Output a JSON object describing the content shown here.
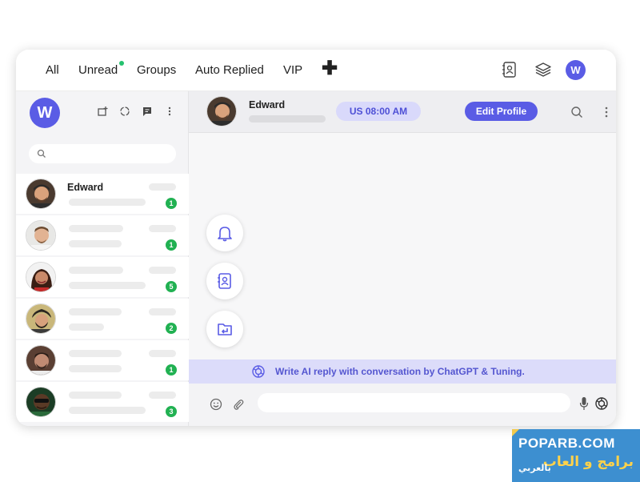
{
  "topbar": {
    "tabs": [
      {
        "label": "All"
      },
      {
        "label": "Unread"
      },
      {
        "label": "Groups"
      },
      {
        "label": "Auto Replied"
      },
      {
        "label": "VIP"
      }
    ],
    "add_icon": "plus-icon",
    "right_icons": [
      "contacts-book-icon",
      "layers-icon",
      "brand-logo"
    ],
    "unread_dot_color": "#25c16f"
  },
  "sidebar": {
    "header_icons": [
      "new-chat-icon",
      "status-icon",
      "message-icon",
      "more-vertical-icon"
    ],
    "search": {
      "placeholder": "",
      "value": ""
    },
    "chats": [
      {
        "name": "Edward",
        "unread": "1"
      },
      {
        "name": "",
        "unread": "1"
      },
      {
        "name": "",
        "unread": "5"
      },
      {
        "name": "",
        "unread": "2"
      },
      {
        "name": "",
        "unread": "1"
      },
      {
        "name": "",
        "unread": "3"
      }
    ]
  },
  "chat": {
    "contact_name": "Edward",
    "local_time": "US 08:00 AM",
    "edit_profile_label": "Edit Profile",
    "floating_actions": [
      "bell-icon",
      "contact-card-icon",
      "folder-reply-icon"
    ],
    "ai_banner": "Write AI reply with conversation by ChatGPT & Tuning.",
    "message_input": {
      "placeholder": "",
      "value": ""
    }
  },
  "colors": {
    "accent": "#5a5ce5",
    "badge": "#21b152",
    "ai_banner_bg": "#dcdcfa"
  },
  "watermark": {
    "site": "POPARB.COM",
    "arabic_title": "برامج و العاب",
    "arabic_sub": "بالعربي"
  }
}
